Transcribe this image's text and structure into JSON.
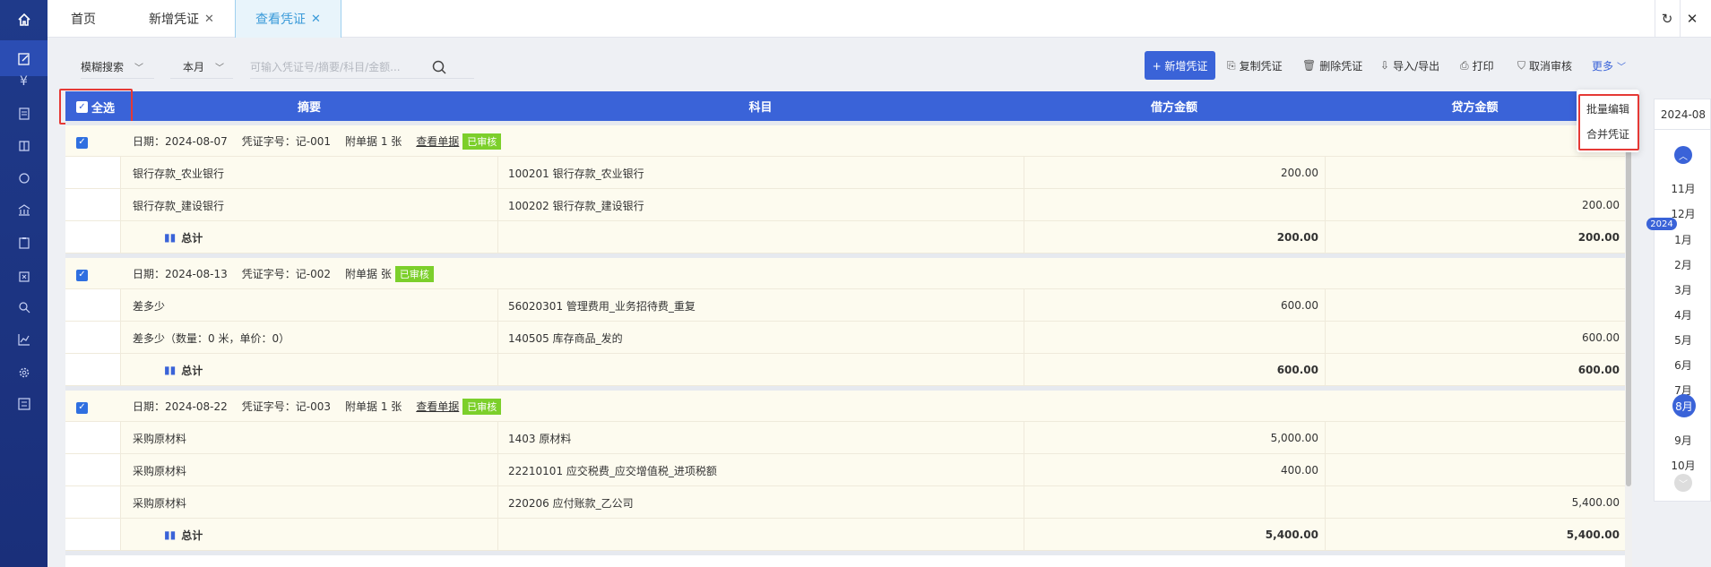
{
  "tabs": [
    {
      "label": "首页",
      "active": false,
      "closable": false
    },
    {
      "label": "新增凭证",
      "active": false,
      "closable": true
    },
    {
      "label": "查看凭证",
      "active": true,
      "closable": true
    }
  ],
  "toolbar": {
    "search_mode": "模糊搜索",
    "period": "本月",
    "search_placeholder": "可输入凭证号/摘要/科目/金额...",
    "add_label": "+ 新增凭证",
    "copy_label": "复制凭证",
    "delete_label": "删除凭证",
    "import_export_label": "导入/导出",
    "print_label": "打印",
    "unaudit_label": "取消审核",
    "more_label": "更多"
  },
  "more_menu": {
    "items": [
      "批量编辑",
      "合并凭证"
    ]
  },
  "table": {
    "select_all": "全选",
    "headers": [
      "摘要",
      "科目",
      "借方金额",
      "贷方金额"
    ],
    "groups": [
      {
        "date": "日期：2024-08-07",
        "voucher_no": "凭证字号：记-001",
        "attachments": "附单据 1 张",
        "view_link": "查看单据",
        "status": "已审核",
        "rows": [
          {
            "summary": "银行存款_农业银行",
            "account": "100201  银行存款_农业银行",
            "debit": "200.00",
            "credit": ""
          },
          {
            "summary": "银行存款_建设银行",
            "account": "100202  银行存款_建设银行",
            "debit": "",
            "credit": "200.00"
          }
        ],
        "total_label": "总计",
        "total_debit": "200.00",
        "total_credit": "200.00"
      },
      {
        "date": "日期：2024-08-13",
        "voucher_no": "凭证字号：记-002",
        "attachments": "附单据  张",
        "view_link": "",
        "status": "已审核",
        "rows": [
          {
            "summary": "差多少",
            "account": "56020301  管理费用_业务招待费_重复",
            "debit": "600.00",
            "credit": ""
          },
          {
            "summary": "差多少（数量：0 米，单价：0）",
            "account": "140505  库存商品_发的",
            "debit": "",
            "credit": "600.00"
          }
        ],
        "total_label": "总计",
        "total_debit": "600.00",
        "total_credit": "600.00"
      },
      {
        "date": "日期：2024-08-22",
        "voucher_no": "凭证字号：记-003",
        "attachments": "附单据 1 张",
        "view_link": "查看单据",
        "status": "已审核",
        "rows": [
          {
            "summary": "采购原材料",
            "account": "1403  原材料",
            "debit": "5,000.00",
            "credit": ""
          },
          {
            "summary": "采购原材料",
            "account": "22210101  应交税费_应交增值税_进项税额",
            "debit": "400.00",
            "credit": ""
          },
          {
            "summary": "采购原材料",
            "account": "220206  应付账款_乙公司",
            "debit": "",
            "credit": "5,400.00"
          }
        ],
        "total_label": "总计",
        "total_debit": "5,400.00",
        "total_credit": "5,400.00"
      }
    ]
  },
  "month_panel": {
    "current": "2024-08",
    "year_badge": "2024",
    "months": [
      "11月",
      "12月",
      "1月",
      "2月",
      "3月",
      "4月",
      "5月",
      "6月",
      "7月",
      "8月",
      "9月",
      "10月"
    ],
    "selected": "8月"
  }
}
